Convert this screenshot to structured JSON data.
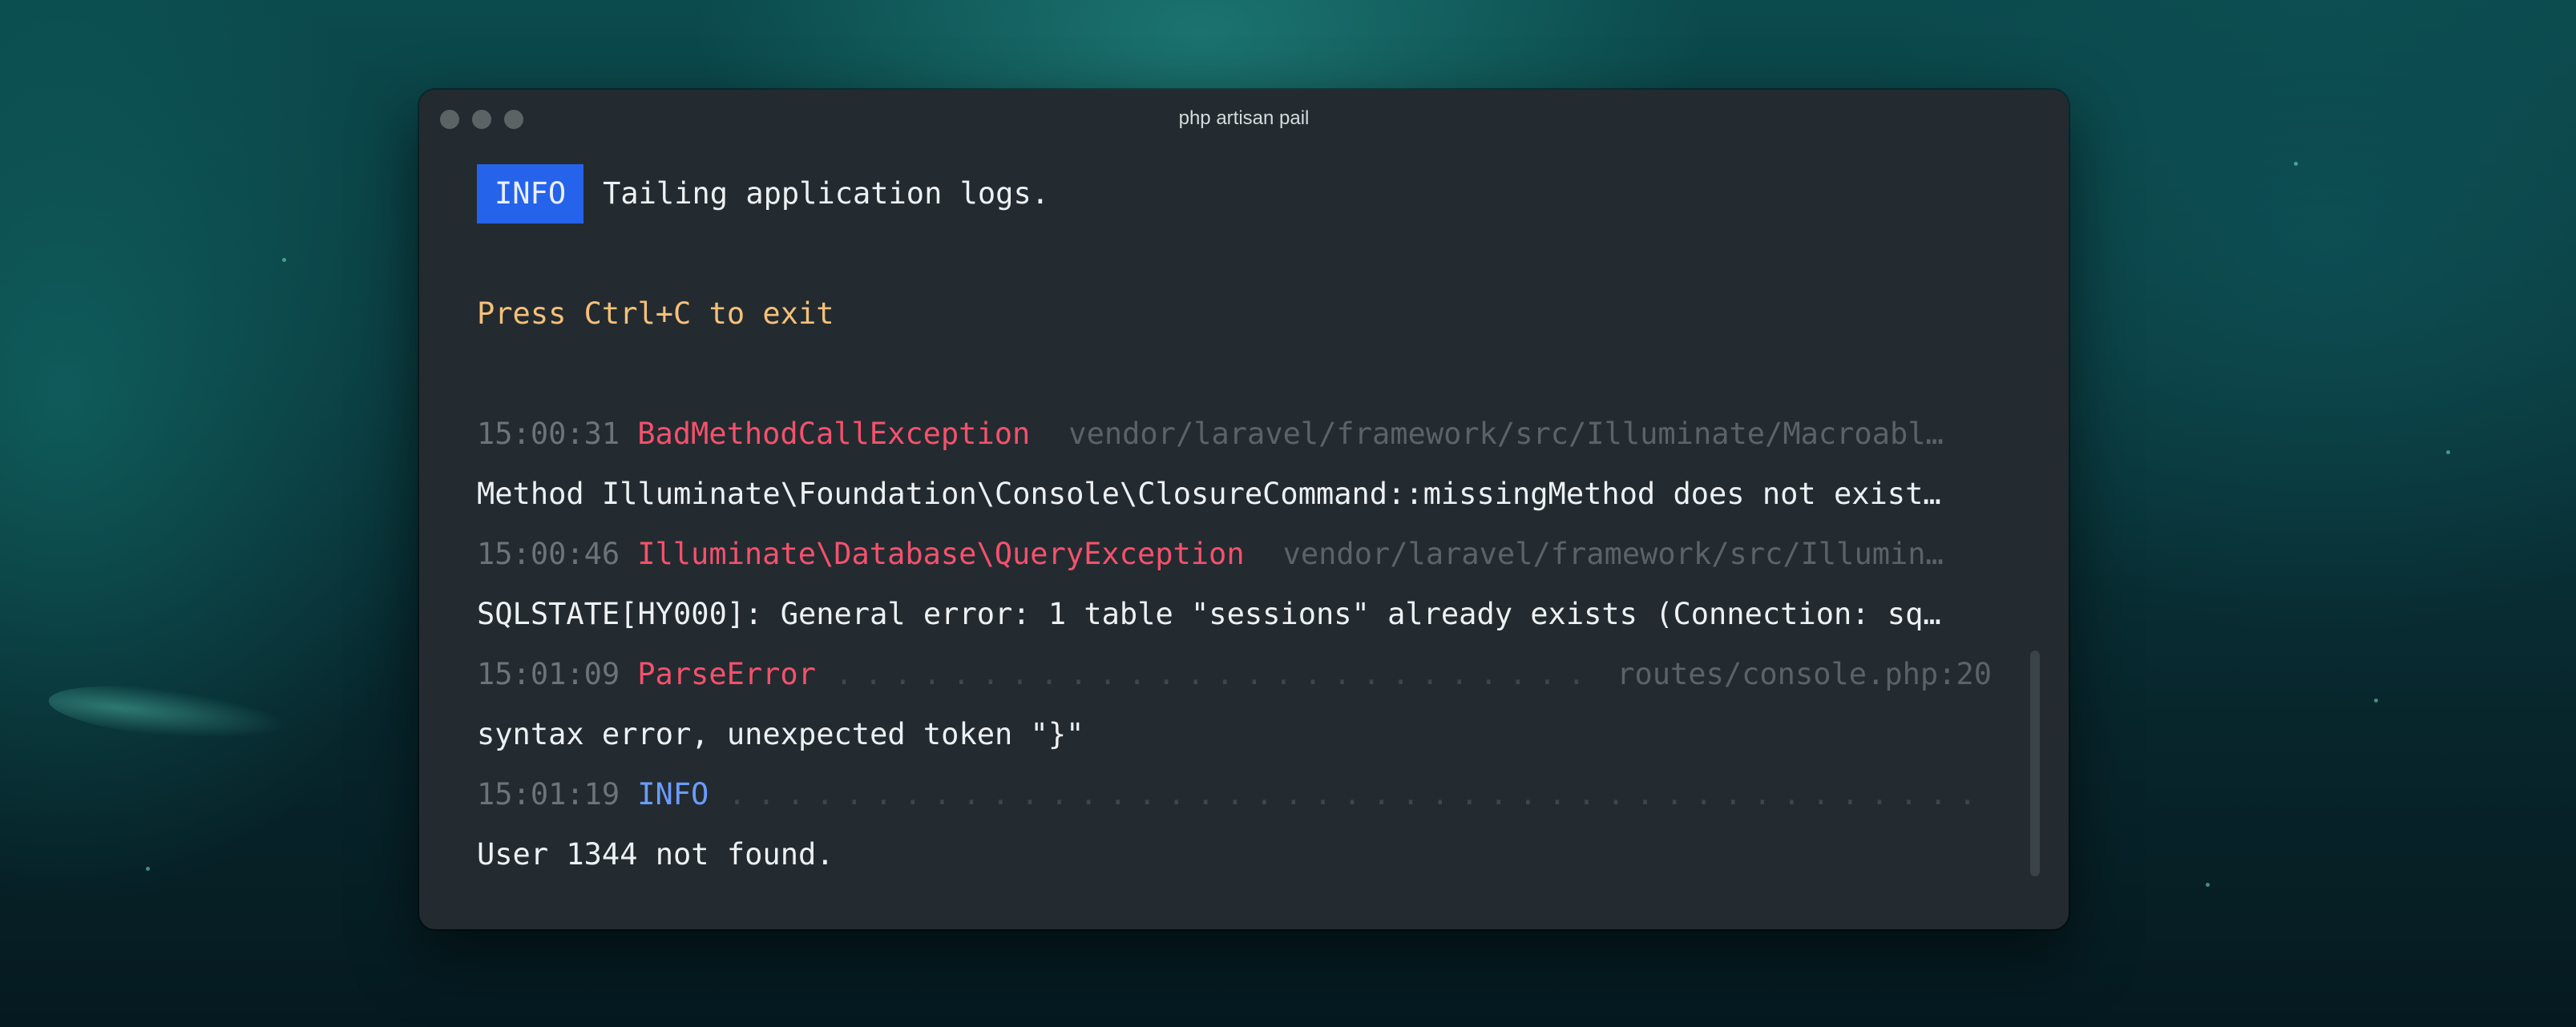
{
  "window": {
    "title": "php artisan pail"
  },
  "header": {
    "badge": "INFO",
    "message": "Tailing application logs.",
    "exit_hint": "Press Ctrl+C to exit"
  },
  "logs": [
    {
      "time": "15:00:31",
      "type": "BadMethodCallException",
      "location": "vendor/laravel/framework/src/Illuminate/Macroabl…",
      "message": "Method Illuminate\\Foundation\\Console\\ClosureCommand::missingMethod does not exist…"
    },
    {
      "time": "15:00:46",
      "type": "Illuminate\\Database\\QueryException",
      "location": "vendor/laravel/framework/src/Illumin…",
      "message": "SQLSTATE[HY000]: General error: 1 table \"sessions\" already exists (Connection: sq…"
    },
    {
      "time": "15:01:09",
      "type": "ParseError",
      "location": "routes/console.php:20",
      "message": "syntax error, unexpected token \"}\""
    },
    {
      "time": "15:01:19",
      "type": "INFO",
      "location": "",
      "message": "User 1344 not found."
    }
  ],
  "colors": {
    "badge_bg": "#2563eb",
    "exception": "#f4516c",
    "info": "#6b9cff",
    "hint": "#f5c07a",
    "muted": "#6a7479"
  }
}
